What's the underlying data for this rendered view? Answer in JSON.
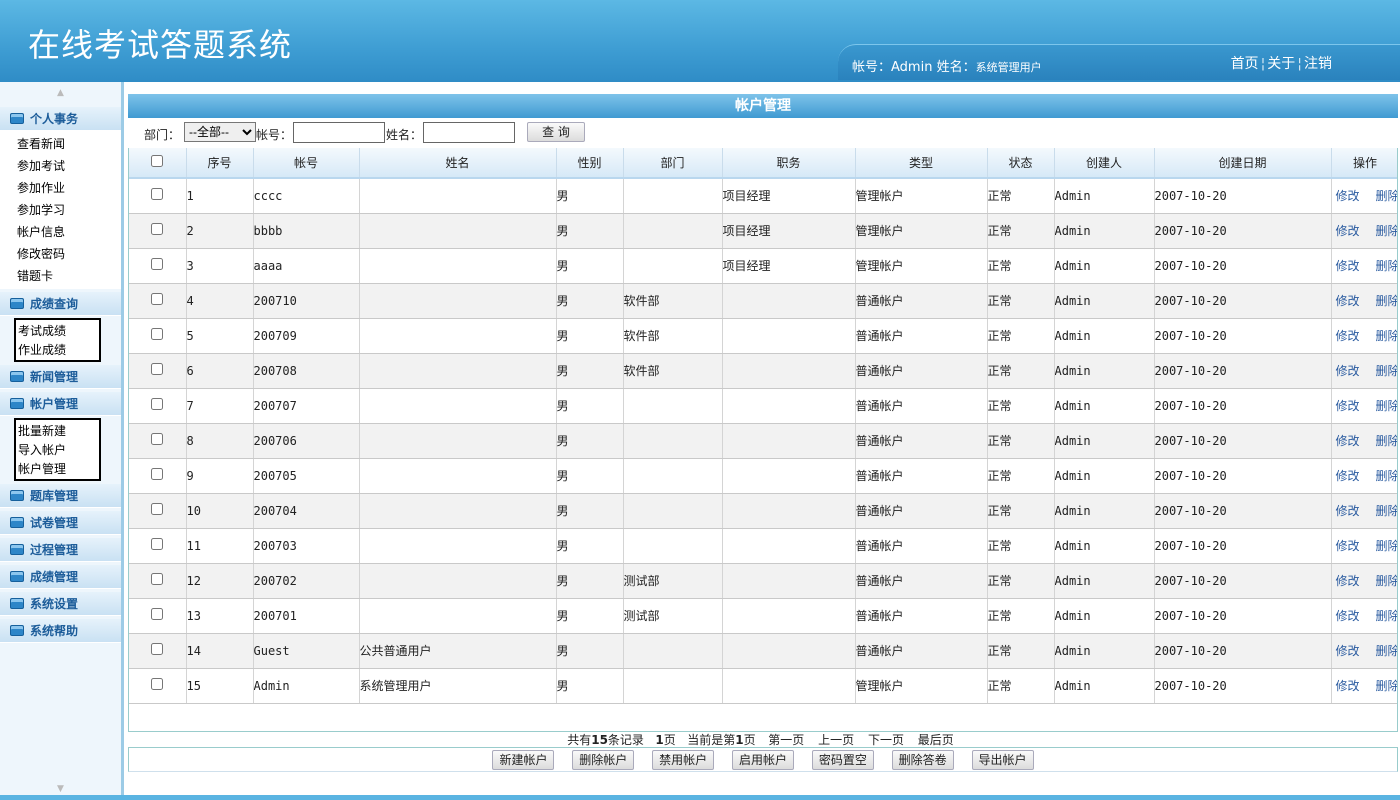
{
  "header": {
    "title": "在线考试答题系统",
    "account_label": "帐号：",
    "account": "Admin",
    "name_label": "姓名：",
    "name": "系统管理用户",
    "links": [
      "首页",
      "关于",
      "注销"
    ]
  },
  "sidebar": {
    "groups": [
      {
        "label": "个人事务",
        "items": [
          "查看新闻",
          "参加考试",
          "参加作业",
          "参加学习",
          "帐户信息",
          "修改密码",
          "错题卡"
        ]
      },
      {
        "label": "成绩查询",
        "items": [
          "考试成绩",
          "作业成绩"
        ]
      },
      {
        "label": "新闻管理",
        "items": []
      },
      {
        "label": "帐户管理",
        "items": [
          "批量新建",
          "导入帐户",
          "帐户管理"
        ]
      },
      {
        "label": "题库管理",
        "items": []
      },
      {
        "label": "试卷管理",
        "items": []
      },
      {
        "label": "过程管理",
        "items": []
      },
      {
        "label": "成绩管理",
        "items": []
      },
      {
        "label": "系统设置",
        "items": []
      },
      {
        "label": "系统帮助",
        "items": []
      }
    ]
  },
  "main": {
    "title": "帐户管理",
    "search": {
      "dept_label": "部门：",
      "dept_selected": "--全部--",
      "account_label": "帐号：",
      "account_value": "",
      "name_label": "姓名：",
      "name_value": "",
      "query_button": "查 询"
    },
    "columns": [
      "序号",
      "帐号",
      "姓名",
      "性别",
      "部门",
      "职务",
      "类型",
      "状态",
      "创建人",
      "创建日期",
      "操作"
    ],
    "rows": [
      [
        "1",
        "cccc",
        "",
        "男",
        "",
        "项目经理",
        "管理帐户",
        "正常",
        "Admin",
        "2007-10-20"
      ],
      [
        "2",
        "bbbb",
        "",
        "男",
        "",
        "项目经理",
        "管理帐户",
        "正常",
        "Admin",
        "2007-10-20"
      ],
      [
        "3",
        "aaaa",
        "",
        "男",
        "",
        "项目经理",
        "管理帐户",
        "正常",
        "Admin",
        "2007-10-20"
      ],
      [
        "4",
        "200710",
        "",
        "男",
        "软件部",
        "",
        "普通帐户",
        "正常",
        "Admin",
        "2007-10-20"
      ],
      [
        "5",
        "200709",
        "",
        "男",
        "软件部",
        "",
        "普通帐户",
        "正常",
        "Admin",
        "2007-10-20"
      ],
      [
        "6",
        "200708",
        "",
        "男",
        "软件部",
        "",
        "普通帐户",
        "正常",
        "Admin",
        "2007-10-20"
      ],
      [
        "7",
        "200707",
        "",
        "男",
        "",
        "",
        "普通帐户",
        "正常",
        "Admin",
        "2007-10-20"
      ],
      [
        "8",
        "200706",
        "",
        "男",
        "",
        "",
        "普通帐户",
        "正常",
        "Admin",
        "2007-10-20"
      ],
      [
        "9",
        "200705",
        "",
        "男",
        "",
        "",
        "普通帐户",
        "正常",
        "Admin",
        "2007-10-20"
      ],
      [
        "10",
        "200704",
        "",
        "男",
        "",
        "",
        "普通帐户",
        "正常",
        "Admin",
        "2007-10-20"
      ],
      [
        "11",
        "200703",
        "",
        "男",
        "",
        "",
        "普通帐户",
        "正常",
        "Admin",
        "2007-10-20"
      ],
      [
        "12",
        "200702",
        "",
        "男",
        "测试部",
        "",
        "普通帐户",
        "正常",
        "Admin",
        "2007-10-20"
      ],
      [
        "13",
        "200701",
        "",
        "男",
        "测试部",
        "",
        "普通帐户",
        "正常",
        "Admin",
        "2007-10-20"
      ],
      [
        "14",
        "Guest",
        "公共普通用户",
        "男",
        "",
        "",
        "普通帐户",
        "正常",
        "Admin",
        "2007-10-20"
      ],
      [
        "15",
        "Admin",
        "系统管理用户",
        "男",
        "",
        "",
        "管理帐户",
        "正常",
        "Admin",
        "2007-10-20"
      ]
    ],
    "row_actions": {
      "edit": "修改",
      "delete": "删除"
    },
    "pager": {
      "total_pre": "共有",
      "total": "15",
      "total_post": "条记录",
      "pages": "1",
      "pages_post": "页",
      "current_pre": "当前是第",
      "current": "1",
      "current_post": "页",
      "first": "第一页",
      "prev": "上一页",
      "next": "下一页",
      "last": "最后页"
    },
    "actions": [
      "新建帐户",
      "删除帐户",
      "禁用帐户",
      "启用帐户",
      "密码置空",
      "删除答卷",
      "导出帐户"
    ]
  }
}
